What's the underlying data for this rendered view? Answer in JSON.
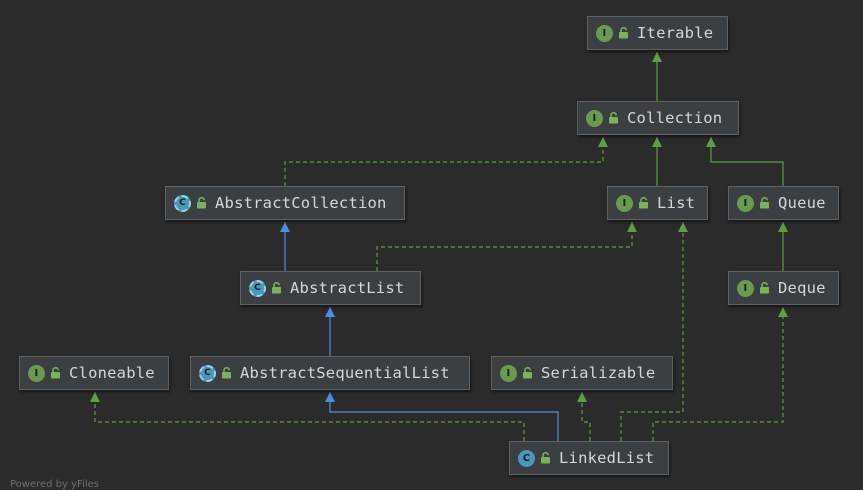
{
  "nodes": [
    {
      "id": "iterable",
      "label": "Iterable",
      "kind": "interface",
      "badge": "I"
    },
    {
      "id": "collection",
      "label": "Collection",
      "kind": "interface",
      "badge": "I"
    },
    {
      "id": "abstract-collection",
      "label": "AbstractCollection",
      "kind": "abstract",
      "badge": "C"
    },
    {
      "id": "list",
      "label": "List",
      "kind": "interface",
      "badge": "I"
    },
    {
      "id": "queue",
      "label": "Queue",
      "kind": "interface",
      "badge": "I"
    },
    {
      "id": "abstract-list",
      "label": "AbstractList",
      "kind": "abstract",
      "badge": "C"
    },
    {
      "id": "deque",
      "label": "Deque",
      "kind": "interface",
      "badge": "I"
    },
    {
      "id": "cloneable",
      "label": "Cloneable",
      "kind": "interface",
      "badge": "I"
    },
    {
      "id": "abstract-sequential-list",
      "label": "AbstractSequentialList",
      "kind": "abstract",
      "badge": "C"
    },
    {
      "id": "serializable",
      "label": "Serializable",
      "kind": "interface",
      "badge": "I"
    },
    {
      "id": "linked-list",
      "label": "LinkedList",
      "kind": "class",
      "badge": "C"
    }
  ],
  "edges": [
    {
      "from": "collection",
      "to": "iterable",
      "type": "extends"
    },
    {
      "from": "list",
      "to": "collection",
      "type": "extends"
    },
    {
      "from": "queue",
      "to": "collection",
      "type": "extends"
    },
    {
      "from": "abstract-collection",
      "to": "collection",
      "type": "implements"
    },
    {
      "from": "abstract-list",
      "to": "abstract-collection",
      "type": "class-extends"
    },
    {
      "from": "abstract-list",
      "to": "list",
      "type": "implements"
    },
    {
      "from": "deque",
      "to": "queue",
      "type": "extends"
    },
    {
      "from": "abstract-sequential-list",
      "to": "abstract-list",
      "type": "class-extends"
    },
    {
      "from": "linked-list",
      "to": "abstract-sequential-list",
      "type": "class-extends"
    },
    {
      "from": "linked-list",
      "to": "cloneable",
      "type": "implements"
    },
    {
      "from": "linked-list",
      "to": "serializable",
      "type": "implements"
    },
    {
      "from": "linked-list",
      "to": "list",
      "type": "implements"
    },
    {
      "from": "linked-list",
      "to": "deque",
      "type": "implements"
    }
  ],
  "colors": {
    "background": "#2b2b2b",
    "node_fill": "#3c3f41",
    "node_border": "#5f6265",
    "text": "#d6d6d6",
    "interface_badge": "#6a9a4f",
    "class_badge": "#4a97b8",
    "implements_line": "#5f9e45",
    "class_extends_line": "#4b8fe0",
    "lock_icon": "#7cb35a"
  },
  "icons": {
    "lock": "lock-icon",
    "interface": "interface-icon",
    "class": "class-icon",
    "abstract_class": "abstract-class-icon"
  },
  "footer": {
    "text": "Powered by yFiles"
  }
}
